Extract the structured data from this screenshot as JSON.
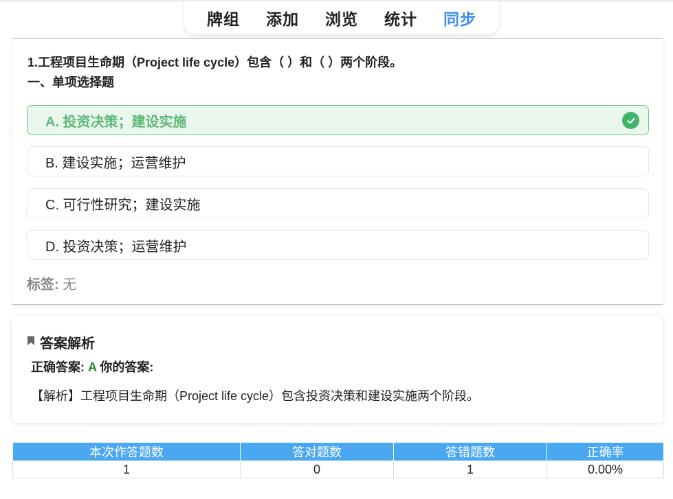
{
  "nav": {
    "tabs": [
      {
        "label": "牌组"
      },
      {
        "label": "添加"
      },
      {
        "label": "浏览"
      },
      {
        "label": "统计"
      },
      {
        "label": "同步"
      }
    ],
    "active_index": 4
  },
  "question": {
    "title": "1.工程项目生命期（Project life cycle）包含（ ）和（ ）两个阶段。",
    "type": "一、单项选择题",
    "options": [
      {
        "label": "A. 投资决策；建设实施",
        "state": "correct"
      },
      {
        "label": "B. 建设实施；运营维护",
        "state": "normal"
      },
      {
        "label": "C. 可行性研究；建设实施",
        "state": "normal"
      },
      {
        "label": "D. 投资决策；运营维护",
        "state": "normal"
      }
    ],
    "tags_label": "标签:",
    "tags_value": "无"
  },
  "answer": {
    "title": "答案解析",
    "correct_label": "正确答案:",
    "correct_value": "A",
    "your_label": "你的答案:",
    "your_value": "",
    "explanation": "【解析】工程项目生命期（Project life cycle）包含投资决策和建设实施两个阶段。"
  },
  "stats": {
    "headers": [
      "本次作答题数",
      "答对题数",
      "答错题数",
      "正确率"
    ],
    "values": [
      "1",
      "0",
      "1",
      "0.00%"
    ]
  },
  "colors": {
    "accent": "#3b8def",
    "correct_bg": "#eaf7ec",
    "correct_text": "#5cb878",
    "check": "#3fb36a",
    "table_header": "#4aa8f0"
  },
  "icons": {
    "check": "check-circle-icon",
    "bookmark": "bookmark-icon"
  }
}
